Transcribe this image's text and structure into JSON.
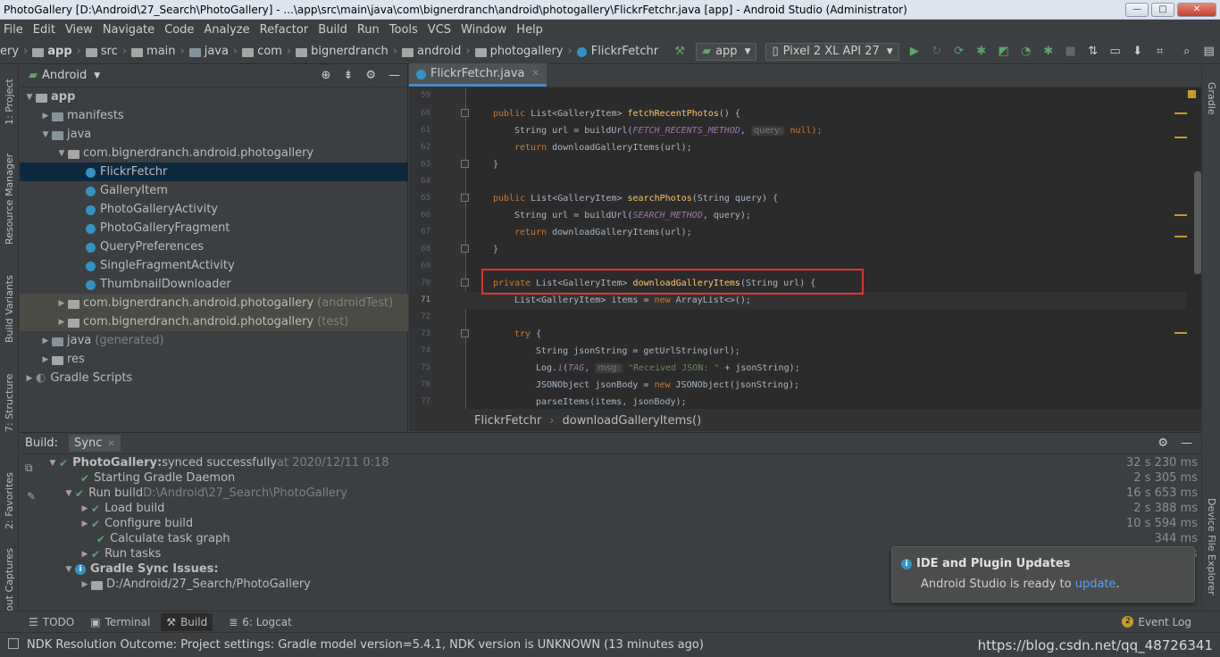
{
  "window": {
    "title": "PhotoGallery [D:\\Android\\27_Search\\PhotoGallery] - ...\\app\\src\\main\\java\\com\\bignerdranch\\android\\photogallery\\FlickrFetchr.java [app] - Android Studio (Administrator)",
    "minimize": "—",
    "maximize": "□",
    "close": "✕"
  },
  "menu": [
    "File",
    "Edit",
    "View",
    "Navigate",
    "Code",
    "Analyze",
    "Refactor",
    "Build",
    "Run",
    "Tools",
    "VCS",
    "Window",
    "Help"
  ],
  "nav": {
    "crumbs": [
      "ery",
      "app",
      "src",
      "main",
      "java",
      "com",
      "bignerdranch",
      "android",
      "photogallery",
      "FlickrFetchr"
    ],
    "run_config": "app",
    "device": "Pixel 2 XL API 27"
  },
  "left_strip": [
    "1: Project",
    "Resource Manager",
    "Build Variants",
    "7: Structure",
    "2: Favorites",
    "out Captures"
  ],
  "right_strip": [
    "Gradle",
    "Device File Explorer"
  ],
  "project": {
    "view_label": "Android",
    "tree": [
      {
        "label": "app",
        "suffix": ""
      },
      {
        "label": "manifests",
        "suffix": ""
      },
      {
        "label": "java",
        "suffix": ""
      },
      {
        "label": "com.bignerdranch.android.photogallery",
        "suffix": ""
      },
      {
        "label": "FlickrFetchr",
        "suffix": ""
      },
      {
        "label": "GalleryItem",
        "suffix": ""
      },
      {
        "label": "PhotoGalleryActivity",
        "suffix": ""
      },
      {
        "label": "PhotoGalleryFragment",
        "suffix": ""
      },
      {
        "label": "QueryPreferences",
        "suffix": ""
      },
      {
        "label": "SingleFragmentActivity",
        "suffix": ""
      },
      {
        "label": "ThumbnailDownloader",
        "suffix": ""
      },
      {
        "label": "com.bignerdranch.android.photogallery",
        "suffix": "(androidTest)"
      },
      {
        "label": "com.bignerdranch.android.photogallery",
        "suffix": "(test)"
      },
      {
        "label": "java",
        "suffix": "(generated)"
      },
      {
        "label": "res",
        "suffix": ""
      },
      {
        "label": "Gradle Scripts",
        "suffix": ""
      }
    ]
  },
  "editor": {
    "tab": "FlickrFetchr.java",
    "line_numbers": [
      "59",
      "60",
      "61",
      "62",
      "63",
      "64",
      "65",
      "66",
      "67",
      "68",
      "69",
      "70",
      "71",
      "72",
      "73",
      "74",
      "75",
      "76",
      "77"
    ],
    "code": {
      "l60": [
        "public",
        " List<GalleryItem> ",
        "fetchRecentPhotos",
        "() {"
      ],
      "l61": [
        "String url = buildUrl(",
        "FETCH_RECENTS_METHOD",
        ", ",
        "query:",
        " null);"
      ],
      "l62": [
        "return",
        " downloadGalleryItems(url);"
      ],
      "l63": "}",
      "l65": [
        "public",
        " List<GalleryItem> ",
        "searchPhotos",
        "(String query) {"
      ],
      "l66": [
        "String url = buildUrl(",
        "SEARCH_METHOD",
        ", query);"
      ],
      "l67": [
        "return",
        " downloadGalleryItems(url);"
      ],
      "l68": "}",
      "l70": [
        "private",
        " List<GalleryItem> ",
        "downloadGalleryItems",
        "(String url) {"
      ],
      "l71": [
        "List<GalleryItem> items = ",
        "new",
        " ArrayList<>();"
      ],
      "l73": [
        "try",
        " {"
      ],
      "l74": "String jsonString = getUrlString(url);",
      "l75": [
        "Log.",
        "i",
        "(",
        "TAG",
        ", ",
        "msg:",
        " ",
        "\"Received JSON: \"",
        " + jsonString);"
      ],
      "l76": [
        "JSONObject jsonBody = ",
        "new",
        " JSONObject(jsonString);"
      ],
      "l77": "parseItems(items, jsonBody);"
    },
    "breadcrumb": [
      "FlickrFetchr",
      "downloadGalleryItems()"
    ]
  },
  "build": {
    "tab_build": "Build:",
    "tab_sync": "Sync",
    "rows": [
      {
        "bold": "PhotoGallery:",
        "text": " synced successfully",
        "extra": " at 2020/12/11 0:18",
        "time": "32 s 230 ms"
      },
      {
        "bold": "",
        "text": "Starting Gradle Daemon",
        "extra": "",
        "time": "2 s 305 ms"
      },
      {
        "bold": "",
        "text": "Run build",
        "extra": " D:\\Android\\27_Search\\PhotoGallery",
        "time": "16 s 653 ms"
      },
      {
        "bold": "",
        "text": "Load build",
        "extra": "",
        "time": "2 s 388 ms"
      },
      {
        "bold": "",
        "text": "Configure build",
        "extra": "",
        "time": "10 s 594 ms"
      },
      {
        "bold": "",
        "text": "Calculate task graph",
        "extra": "",
        "time": "344 ms"
      },
      {
        "bold": "",
        "text": "Run tasks",
        "extra": "",
        "time": "3 s"
      },
      {
        "bold": "Gradle Sync Issues:",
        "text": "",
        "extra": "",
        "time": ""
      },
      {
        "bold": "",
        "text": "D:/Android/27_Search/PhotoGallery",
        "extra": "",
        "time": ""
      }
    ]
  },
  "popup": {
    "title": "IDE and Plugin Updates",
    "body": "Android Studio is ready to ",
    "link": "update",
    "tail": "."
  },
  "bottom_tabs": [
    "TODO",
    "Terminal",
    "Build",
    "6: Logcat"
  ],
  "event_log": {
    "count": "2",
    "label": "Event Log"
  },
  "status": {
    "text": "NDK Resolution Outcome: Project settings: Gradle model version=5.4.1, NDK version is UNKNOWN (13 minutes ago)",
    "watermark": "https://blog.csdn.net/qq_48726341"
  },
  "colors": {
    "accent": "#4a88c7",
    "keyword": "#cc7832",
    "method": "#ffc66d",
    "constant": "#9876aa",
    "string": "#6a8759",
    "success": "#59a869",
    "highlight_box": "#e03131"
  }
}
